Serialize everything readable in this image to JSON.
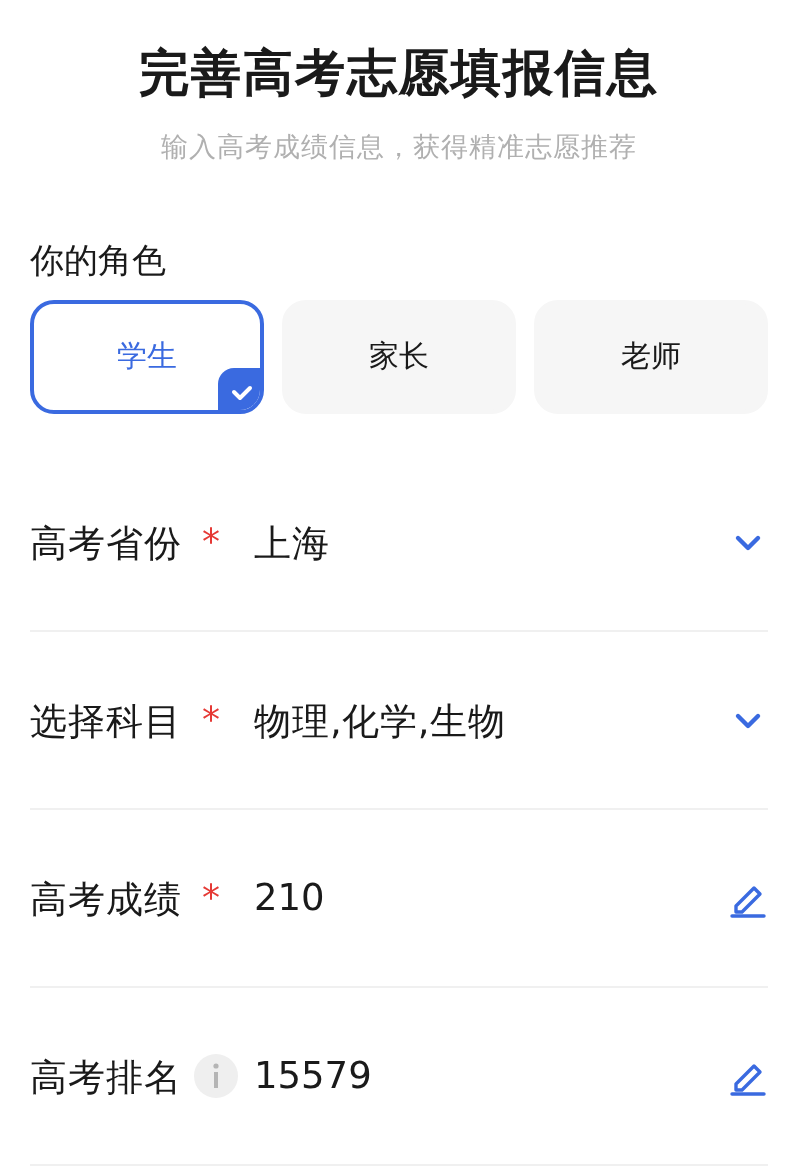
{
  "title": "完善高考志愿填报信息",
  "subtitle": "输入高考成绩信息，获得精准志愿推荐",
  "role": {
    "label": "你的角色",
    "options": [
      {
        "label": "学生",
        "selected": true
      },
      {
        "label": "家长",
        "selected": false
      },
      {
        "label": "老师",
        "selected": false
      }
    ]
  },
  "fields": [
    {
      "label": "高考省份",
      "marker": {
        "kind": "required",
        "text": "*"
      },
      "value": "上海",
      "kind": "select"
    },
    {
      "label": "选择科目",
      "marker": {
        "kind": "required",
        "text": "*"
      },
      "value": "物理,化学,生物",
      "kind": "select"
    },
    {
      "label": "高考成绩",
      "marker": {
        "kind": "required",
        "text": "*"
      },
      "value": "210",
      "kind": "edit"
    },
    {
      "label": "高考排名",
      "marker": {
        "kind": "info"
      },
      "value": "15579",
      "kind": "edit"
    }
  ]
}
